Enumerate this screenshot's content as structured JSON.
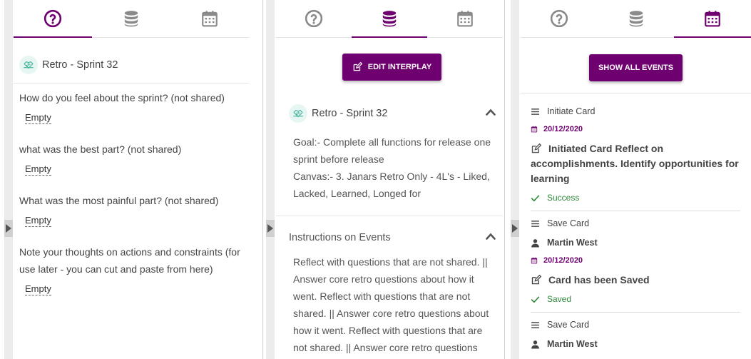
{
  "panel1": {
    "tabs": [
      {
        "icon": "question-circle-icon"
      },
      {
        "icon": "database-icon"
      },
      {
        "icon": "calendar-icon"
      }
    ],
    "active_tab": 0,
    "title": "Retro - Sprint 32",
    "questions": [
      {
        "text": "How do you feel about the sprint? (not shared)",
        "answer": "Empty"
      },
      {
        "text": "what was the best part? (not shared)",
        "answer": "Empty"
      },
      {
        "text": "What was the most painful part? (not shared)",
        "answer": "Empty"
      },
      {
        "text": "Note your thoughts on actions and constraints (for use later - you can cut and paste from here)",
        "answer": "Empty"
      }
    ]
  },
  "panel2": {
    "active_tab": 1,
    "edit_button": "EDIT INTERPLAY",
    "section_title": "Retro - Sprint 32",
    "goal": "Goal:- Complete all functions for release one sprint before release",
    "canvas": "Canvas:- 3. Janars Retro Only - 4L's - Liked, Lacked, Learned, Longed for",
    "instructions_title": "Instructions on Events",
    "instructions_text": "Reflect with questions that are not shared. || Answer core retro questions about how it went. Reflect with questions that are not shared. || Answer core retro questions about how it went. Reflect with questions that are not shared. || Answer core retro questions"
  },
  "panel3": {
    "active_tab": 2,
    "show_button": "SHOW ALL EVENTS",
    "events": [
      {
        "type": "Initiate Card",
        "date": "20/12/2020",
        "message": "Initiated Card Reflect on accomplishments. Identify opportunities for learning",
        "status": "Success"
      },
      {
        "type": "Save Card",
        "user": "Martin West",
        "date": "20/12/2020",
        "message": "Card has been Saved",
        "status": "Saved"
      },
      {
        "type": "Save Card",
        "user": "Martin West"
      }
    ]
  },
  "colors": {
    "accent": "#6f006f",
    "success": "#2e8b3a",
    "teal": "#3fb39a"
  }
}
